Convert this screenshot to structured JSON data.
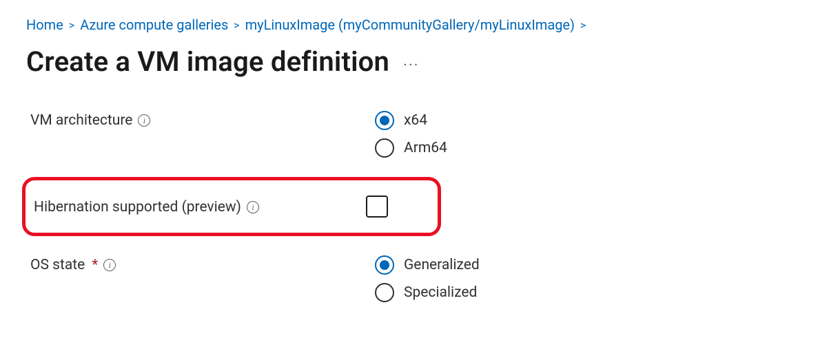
{
  "breadcrumb": {
    "items": [
      {
        "label": "Home"
      },
      {
        "label": "Azure compute galleries"
      },
      {
        "label": "myLinuxImage (myCommunityGallery/myLinuxImage)"
      }
    ]
  },
  "page": {
    "title": "Create a VM image definition"
  },
  "form": {
    "vm_arch": {
      "label": "VM architecture",
      "options": {
        "x64": "x64",
        "arm64": "Arm64"
      },
      "selected": "x64"
    },
    "hibernation": {
      "label": "Hibernation supported (preview)",
      "checked": false
    },
    "os_state": {
      "label": "OS state",
      "required_mark": "*",
      "options": {
        "generalized": "Generalized",
        "specialized": "Specialized"
      },
      "selected": "generalized"
    }
  }
}
